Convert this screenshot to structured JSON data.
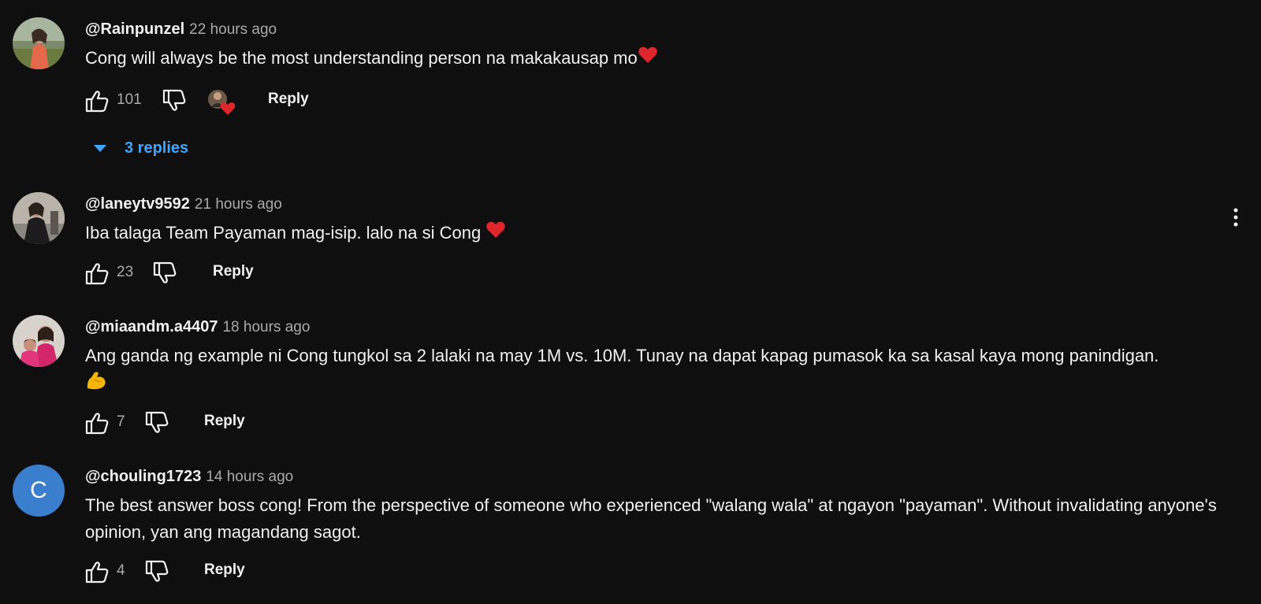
{
  "comments": [
    {
      "author": "@Rainpunzel",
      "time": "22 hours ago",
      "text": "Cong will always be the most understanding person na makakausap mo",
      "likes": "101",
      "reply_label": "Reply",
      "hearted": true,
      "replies_label": "3 replies"
    },
    {
      "author": "@laneytv9592",
      "time": "21 hours ago",
      "text": "Iba talaga Team Payaman mag-isip. lalo na si Cong ",
      "likes": "23",
      "reply_label": "Reply"
    },
    {
      "author": "@miaandm.a4407",
      "time": "18 hours ago",
      "text": "Ang ganda ng example ni Cong tungkol sa 2 lalaki na may 1M vs. 10M. Tunay na dapat kapag pumasok ka sa kasal kaya mong panindigan.",
      "likes": "7",
      "reply_label": "Reply"
    },
    {
      "author": "@chouling1723",
      "time": "14 hours ago",
      "text": "The best answer boss cong! From the perspective of someone who experienced \"walang wala\" at ngayon \"payaman\". Without invalidating anyone's opinion, yan ang magandang sagot.",
      "likes": "4",
      "reply_label": "Reply",
      "avatar_letter": "C"
    }
  ],
  "icons": {
    "like": "thumbs-up-icon",
    "dislike": "thumbs-down-icon",
    "heart": "heart-icon",
    "muscle": "flexed-biceps-emoji",
    "caret": "caret-down-icon",
    "menu": "more-vertical-icon"
  },
  "colors": {
    "background": "#0f0f0f",
    "text": "#f1f1f1",
    "secondary_text": "#aaaaaa",
    "link_blue": "#3ea6ff",
    "heart_red": "#e0262d",
    "avatar_blue": "#3a7fce"
  }
}
